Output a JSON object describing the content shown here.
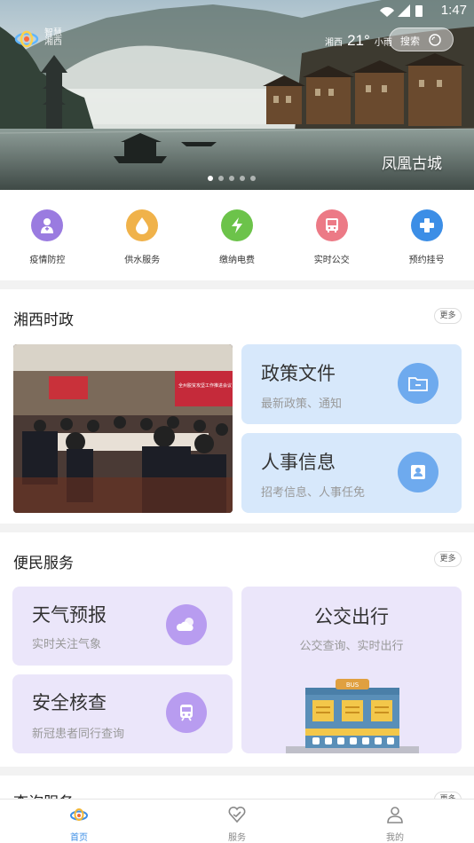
{
  "status_bar": {
    "time": "1:47"
  },
  "header": {
    "logo_text_line1": "智慧",
    "logo_text_line2": "湘西",
    "weather": {
      "city": "湘西",
      "temperature": "21°",
      "condition": "小雨"
    },
    "search_placeholder": "搜索"
  },
  "banner": {
    "caption": "凤凰古城",
    "dot_count": 5,
    "active_dot": 0
  },
  "quick_menu": [
    {
      "label": "疫情防控",
      "icon": "doctor-icon",
      "color": "#9a7be0"
    },
    {
      "label": "供水服务",
      "icon": "water-drop-icon",
      "color": "#f0b24a"
    },
    {
      "label": "缴纳电费",
      "icon": "lightning-icon",
      "color": "#6cc34a"
    },
    {
      "label": "实时公交",
      "icon": "bus-icon",
      "color": "#ec7a86"
    },
    {
      "label": "预约挂号",
      "icon": "medical-cross-icon",
      "color": "#3c8ee6"
    }
  ],
  "politics": {
    "title": "湘西时政",
    "more": "更多",
    "photo_banner": "全州脱贫攻坚工作推进会议",
    "cards": [
      {
        "title": "政策文件",
        "subtitle": "最新政策、通知",
        "icon": "folder-icon"
      },
      {
        "title": "人事信息",
        "subtitle": "招考信息、人事任免",
        "icon": "id-card-icon"
      }
    ]
  },
  "services": {
    "title": "便民服务",
    "more": "更多",
    "cards": [
      {
        "title": "天气预报",
        "subtitle": "实时关注气象",
        "icon": "weather-icon"
      },
      {
        "title": "安全核查",
        "subtitle": "新冠患者同行查询",
        "icon": "train-icon"
      },
      {
        "title": "公交出行",
        "subtitle": "公交查询、实时出行",
        "icon": "bus-station-illustration",
        "sign": "BUS"
      }
    ]
  },
  "query_section": {
    "title": "查询服务",
    "more": "更多"
  },
  "bottom_nav": [
    {
      "label": "首页",
      "icon": "home-icon",
      "active": true
    },
    {
      "label": "服务",
      "icon": "service-icon",
      "active": false
    },
    {
      "label": "我的",
      "icon": "profile-icon",
      "active": false
    }
  ],
  "colors": {
    "accent": "#3c8ee6",
    "politics_card_bg": "#d7e8fb",
    "services_card_bg": "#ebe6fa",
    "services_icon": "#b89cf0"
  }
}
